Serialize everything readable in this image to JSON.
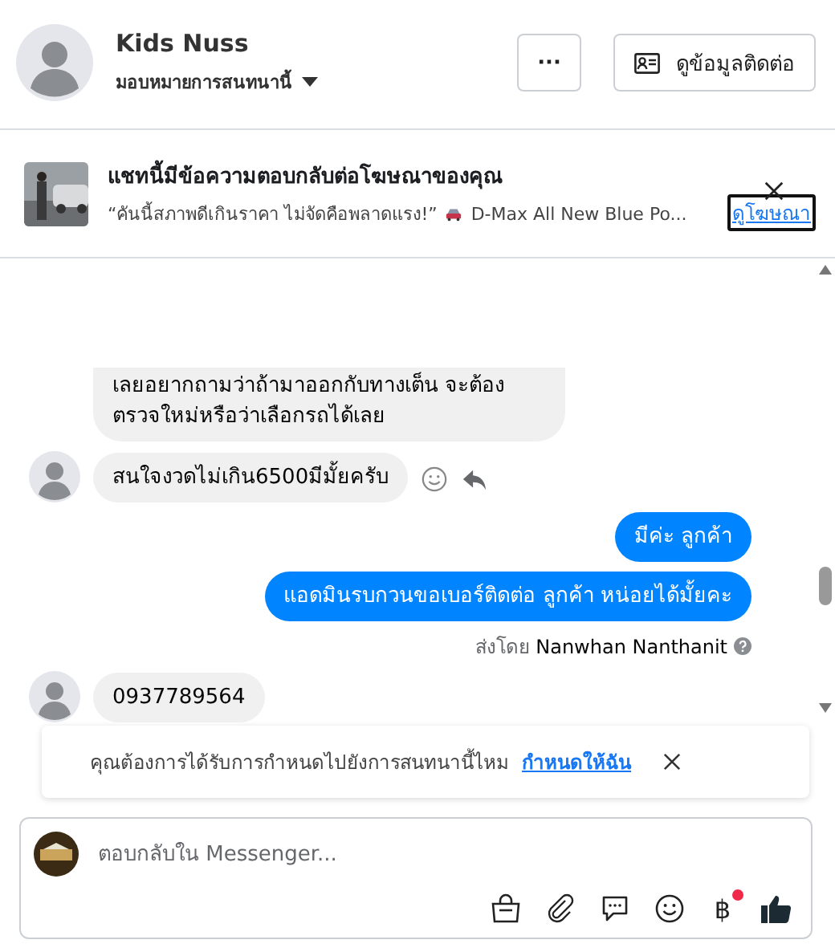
{
  "header": {
    "name": "Kids Nuss",
    "assign_label": "มอบหมายการสนทนานี้",
    "more_button": "···",
    "contact_button": "ดูข้อมูลติดต่อ"
  },
  "ad_banner": {
    "title": "แชทนี้มีข้อความตอบกลับต่อโฆษณาของคุณ",
    "quote": "“คันนี้สภาพดีเกินราคา ไม่จัดคือพลาดแรง!”",
    "detail": "D-Max All New Blue Po...",
    "link": "ดูโฆษณา"
  },
  "messages": [
    {
      "kind": "incoming",
      "text": "เลยอยากถามว่าถ้ามาออกกับทางเต็น จะต้องตรวจใหม่หรือว่าเลือกรถได้เลย",
      "avatar": false,
      "actions": false
    },
    {
      "kind": "incoming",
      "text": "สนใจงวดไม่เกิน6500มีมั้ยครับ",
      "avatar": true,
      "actions": true
    },
    {
      "kind": "outgoing",
      "text": "มีค่ะ  ลูกค้า"
    },
    {
      "kind": "outgoing",
      "text": "แอดมินรบกวนขอเบอร์ติดต่อ ลูกค้า  หน่อยได้มั้ยคะ"
    },
    {
      "kind": "sent_by",
      "prefix": "ส่งโดย",
      "name": "Nanwhan Nanthanit"
    },
    {
      "kind": "incoming",
      "text": "0937789564",
      "avatar": true,
      "actions": false
    }
  ],
  "assign_notice": {
    "text": "คุณต้องการได้รับการกำหนดไปยังการสนทนานี้ไหม",
    "link": "กำหนดให้ฉัน"
  },
  "composer": {
    "placeholder": "ตอบกลับใน Messenger...",
    "currency_symbol": "฿",
    "currency_badge": true
  }
}
